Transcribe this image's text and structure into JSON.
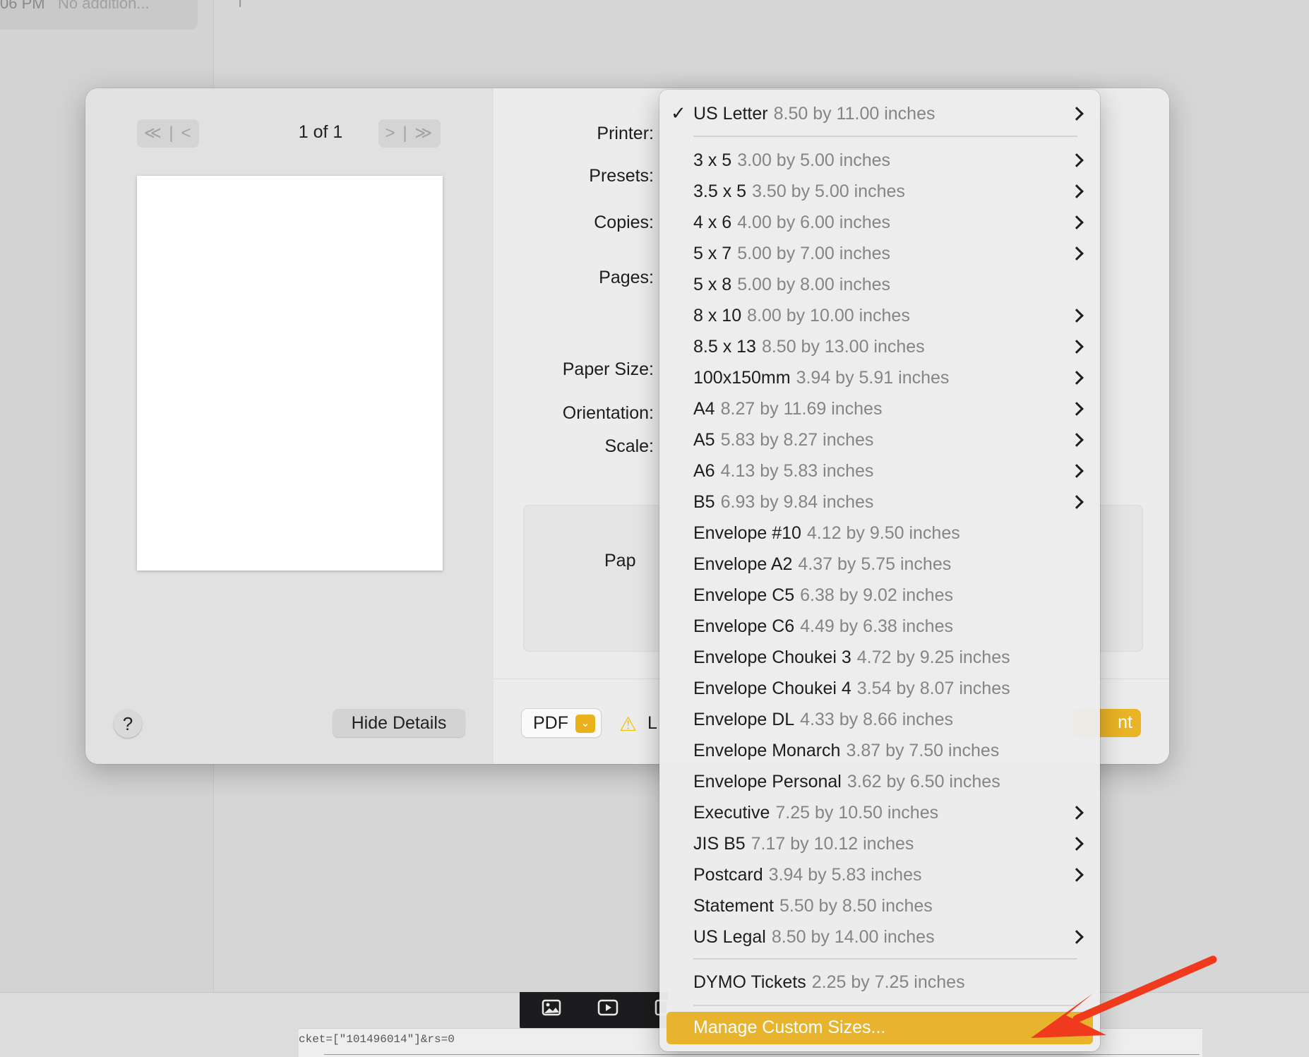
{
  "background": {
    "chip_time": "06 PM",
    "chip_text": "No addition...",
    "cursor_mark": "I",
    "url_fragment": "cket=[\"101496014\"]&rs=0"
  },
  "preview": {
    "first_prev_symbol": "≪ | <",
    "next_last_symbol": "> | ≫",
    "page_count": "1 of 1",
    "help_label": "?",
    "hide_details_label": "Hide Details"
  },
  "settings": {
    "labels": {
      "printer": "Printer:",
      "presets": "Presets:",
      "copies": "Copies:",
      "pages": "Pages:",
      "paper_size": "Paper Size:",
      "orientation": "Orientation:",
      "scale": "Scale:",
      "paper_box": "Pap"
    },
    "pdf_label": "PDF",
    "pdf_arrow": "⌄",
    "warning_icon": "⚠",
    "warning_text": "L",
    "print_label": "nt"
  },
  "menu": {
    "selected": {
      "name": "US Letter",
      "dims": "8.50 by 11.00 inches",
      "check": "✓"
    },
    "items": [
      {
        "name": "3 x 5",
        "dims": "3.00 by 5.00 inches"
      },
      {
        "name": "3.5 x 5",
        "dims": "3.50 by 5.00 inches"
      },
      {
        "name": "4 x 6",
        "dims": "4.00 by 6.00 inches"
      },
      {
        "name": "5 x 7",
        "dims": "5.00 by 7.00 inches"
      },
      {
        "name": "5 x 8",
        "dims": "5.00 by 8.00 inches"
      },
      {
        "name": "8 x 10",
        "dims": "8.00 by 10.00 inches"
      },
      {
        "name": "8.5 x 13",
        "dims": "8.50 by 13.00 inches"
      },
      {
        "name": "100x150mm",
        "dims": "3.94 by 5.91 inches"
      },
      {
        "name": "A4",
        "dims": "8.27 by 11.69 inches"
      },
      {
        "name": "A5",
        "dims": "5.83 by 8.27 inches"
      },
      {
        "name": "A6",
        "dims": "4.13 by 5.83 inches"
      },
      {
        "name": "B5",
        "dims": "6.93 by 9.84 inches"
      },
      {
        "name": "Envelope #10",
        "dims": "4.12 by 9.50 inches"
      },
      {
        "name": "Envelope A2",
        "dims": "4.37 by 5.75 inches"
      },
      {
        "name": "Envelope C5",
        "dims": "6.38 by 9.02 inches"
      },
      {
        "name": "Envelope C6",
        "dims": "4.49 by 6.38 inches"
      },
      {
        "name": "Envelope Choukei 3",
        "dims": "4.72 by 9.25 inches"
      },
      {
        "name": "Envelope Choukei 4",
        "dims": "3.54 by 8.07 inches"
      },
      {
        "name": "Envelope DL",
        "dims": "4.33 by 8.66 inches"
      },
      {
        "name": "Envelope Monarch",
        "dims": "3.87 by 7.50 inches"
      },
      {
        "name": "Envelope Personal",
        "dims": "3.62 by 6.50 inches"
      },
      {
        "name": "Executive",
        "dims": "7.25 by 10.50 inches"
      },
      {
        "name": "JIS B5",
        "dims": "7.17 by 10.12 inches"
      },
      {
        "name": "Postcard",
        "dims": "3.94 by 5.83 inches"
      },
      {
        "name": "Statement",
        "dims": "5.50 by 8.50 inches"
      },
      {
        "name": "US Legal",
        "dims": "8.50 by 14.00 inches"
      }
    ],
    "custom": {
      "name": "DYMO Tickets",
      "dims": "2.25 by 7.25 inches"
    },
    "manage_label": "Manage Custom Sizes..."
  },
  "colors": {
    "accent": "#e8b32d",
    "annotation": "#f03a1e"
  }
}
